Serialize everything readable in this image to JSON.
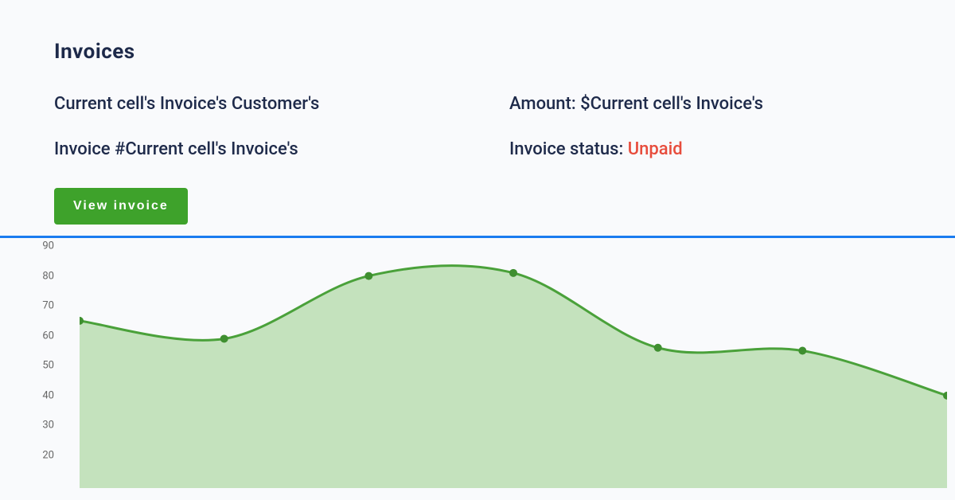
{
  "header": {
    "title": "Invoices"
  },
  "details": {
    "customer_label": "Current cell's Invoice's Customer's",
    "invoice_number_label": "Invoice #Current cell's Invoice's",
    "amount_label": "Amount: $Current cell's Invoice's",
    "status_label": "Invoice status: ",
    "status_value": "Unpaid"
  },
  "actions": {
    "view_invoice": "View invoice"
  },
  "colors": {
    "accent": "#1a7cf0",
    "button": "#3ea22b",
    "status_unpaid": "#e74c3c",
    "chart_fill": "#c4e2bd",
    "chart_line": "#4aa13a"
  },
  "chart_data": {
    "type": "area",
    "y_ticks": [
      90,
      80,
      70,
      60,
      50,
      40,
      30,
      20
    ],
    "ylim": [
      0,
      100
    ],
    "values": [
      65,
      59,
      80,
      81,
      56,
      55,
      40
    ],
    "title": "",
    "xlabel": "",
    "ylabel": ""
  }
}
